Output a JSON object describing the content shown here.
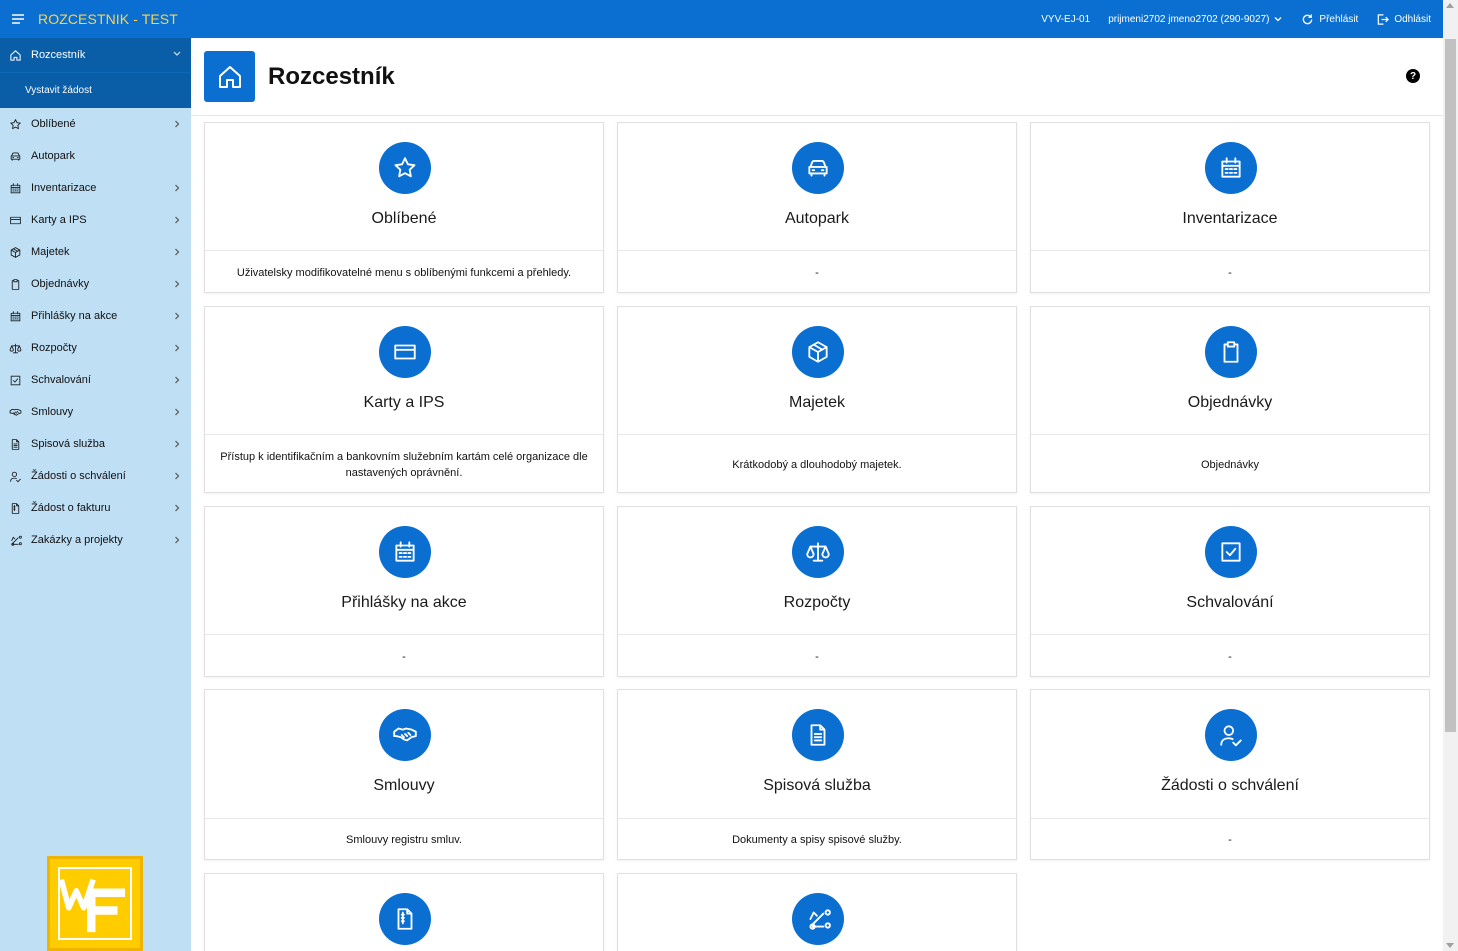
{
  "header": {
    "app_title": "ROZCESTNIK - TEST",
    "env_code": "VYV-EJ-01",
    "user": "prijmeni2702 jmeno2702 (290-9027)",
    "switch_label": "Přehlásit",
    "logout_label": "Odhlásit"
  },
  "sidebar": {
    "active_label": "Rozcestník",
    "sub_label": "Vystavit žádost",
    "items": [
      {
        "label": "Oblíbené",
        "icon": "star-icon",
        "has_arrow": true
      },
      {
        "label": "Autopark",
        "icon": "car-icon",
        "has_arrow": false
      },
      {
        "label": "Inventarizace",
        "icon": "calendar-icon",
        "has_arrow": true
      },
      {
        "label": "Karty a IPS",
        "icon": "credit-card-icon",
        "has_arrow": true
      },
      {
        "label": "Majetek",
        "icon": "box-icon",
        "has_arrow": true
      },
      {
        "label": "Objednávky",
        "icon": "clipboard-icon",
        "has_arrow": true
      },
      {
        "label": "Přihlášky na akce",
        "icon": "calendar-icon",
        "has_arrow": true
      },
      {
        "label": "Rozpočty",
        "icon": "scale-icon",
        "has_arrow": true
      },
      {
        "label": "Schvalování",
        "icon": "checkbox-icon",
        "has_arrow": true
      },
      {
        "label": "Smlouvy",
        "icon": "handshake-icon",
        "has_arrow": true
      },
      {
        "label": "Spisová služba",
        "icon": "document-icon",
        "has_arrow": true
      },
      {
        "label": "Žádosti o schválení",
        "icon": "user-check-icon",
        "has_arrow": true
      },
      {
        "label": "Žádost o fakturu",
        "icon": "invoice-icon",
        "has_arrow": true
      },
      {
        "label": "Zakázky a projekty",
        "icon": "project-icon",
        "has_arrow": true
      }
    ]
  },
  "page": {
    "title": "Rozcestník",
    "help": "?"
  },
  "cards": [
    {
      "title": "Oblíbené",
      "desc": "Uživatelsky modifikovatelné menu s oblíbenými funkcemi a přehledy.",
      "icon": "star-icon"
    },
    {
      "title": "Autopark",
      "desc": "-",
      "icon": "car-icon"
    },
    {
      "title": "Inventarizace",
      "desc": "-",
      "icon": "calendar-icon"
    },
    {
      "title": "Karty a IPS",
      "desc": "Přístup k identifikačním a bankovním služebním kartám celé organizace dle nastavených oprávnění.",
      "icon": "credit-card-icon"
    },
    {
      "title": "Majetek",
      "desc": "Krátkodobý a dlouhodobý majetek.",
      "icon": "box-icon"
    },
    {
      "title": "Objednávky",
      "desc": "Objednávky",
      "icon": "clipboard-icon"
    },
    {
      "title": "Přihlášky na akce",
      "desc": "-",
      "icon": "calendar-icon"
    },
    {
      "title": "Rozpočty",
      "desc": "-",
      "icon": "scale-icon"
    },
    {
      "title": "Schvalování",
      "desc": "-",
      "icon": "checkbox-icon"
    },
    {
      "title": "Smlouvy",
      "desc": "Smlouvy registru smluv.",
      "icon": "handshake-icon"
    },
    {
      "title": "Spisová služba",
      "desc": "Dokumenty a spisy spisové služby.",
      "icon": "document-icon"
    },
    {
      "title": "Žádosti o schválení",
      "desc": "-",
      "icon": "user-check-icon"
    },
    {
      "title": "",
      "desc": "",
      "icon": "invoice-icon"
    },
    {
      "title": "",
      "desc": "",
      "icon": "project-icon"
    }
  ],
  "colors": {
    "brand_blue": "#0a6fd1",
    "title_yellow": "#ffd24a",
    "sidebar_bg": "#bfdff5",
    "sidebar_active": "#0a5ea8"
  }
}
